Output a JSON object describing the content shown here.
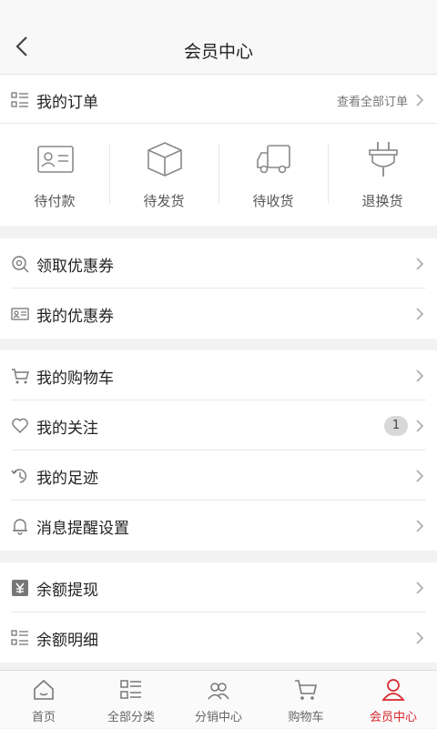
{
  "header": {
    "title": "会员中心",
    "back_icon": "chevron-left-icon"
  },
  "my_orders": {
    "label": "我的订单",
    "view_all": "查看全部订单",
    "icon": "list-icon"
  },
  "order_statuses": [
    {
      "label": "待付款",
      "icon": "card-icon"
    },
    {
      "label": "待发货",
      "icon": "box-icon"
    },
    {
      "label": "待收货",
      "icon": "truck-icon"
    },
    {
      "label": "退换货",
      "icon": "plug-icon"
    }
  ],
  "coupons": [
    {
      "label": "领取优惠券",
      "icon": "coupon-search-icon"
    },
    {
      "label": "我的优惠券",
      "icon": "ticket-icon"
    }
  ],
  "activity": [
    {
      "label": "我的购物车",
      "icon": "cart-icon"
    },
    {
      "label": "我的关注",
      "icon": "heart-icon",
      "badge": "1"
    },
    {
      "label": "我的足迹",
      "icon": "footprint-icon"
    },
    {
      "label": "消息提醒设置",
      "icon": "bell-icon"
    }
  ],
  "balance": [
    {
      "label": "余额提现",
      "icon": "yen-icon"
    },
    {
      "label": "余额明细",
      "icon": "list-icon"
    }
  ],
  "tabbar": [
    {
      "label": "首页",
      "icon": "home-icon"
    },
    {
      "label": "全部分类",
      "icon": "category-icon"
    },
    {
      "label": "分销中心",
      "icon": "users-icon"
    },
    {
      "label": "购物车",
      "icon": "cart-icon"
    },
    {
      "label": "会员中心",
      "icon": "user-icon",
      "active": true
    }
  ],
  "colors": {
    "accent": "#d9262c",
    "icon_gray": "#888888"
  }
}
